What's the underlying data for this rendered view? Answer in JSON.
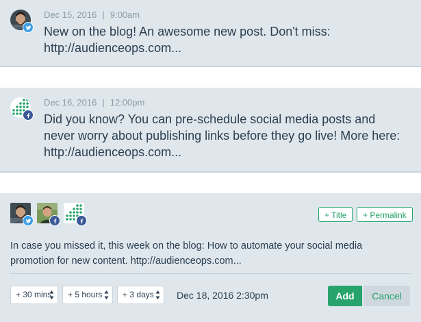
{
  "posts": [
    {
      "network": "twitter",
      "date": "Dec 15, 2016",
      "separator": "|",
      "time": "9:00am",
      "text": "New on the blog! An awesome new post. Don't miss: http://audienceops.com..."
    },
    {
      "network": "facebook",
      "date": "Dec 16, 2016",
      "separator": "|",
      "time": "12:00pm",
      "text": "Did you know? You can pre-schedule social media posts and never worry about publishing links before they go live! More here: http://audienceops.com..."
    }
  ],
  "composer": {
    "accounts": [
      {
        "avatar": "man-with-beard",
        "network": "twitter"
      },
      {
        "avatar": "man-outdoors",
        "network": "facebook"
      },
      {
        "avatar": "green-dots-logo",
        "network": "facebook"
      }
    ],
    "title_button": "+ Title",
    "permalink_button": "+ Permalink",
    "text": "In case you missed it, this week on the blog: How to automate your social media promotion for new content.  http://audienceops.com...",
    "offsets": [
      "+ 30 mins",
      "+ 5 hours",
      "+ 3 days"
    ],
    "scheduled_date": "Dec 18, 2016 2:30pm",
    "add_label": "Add",
    "cancel_label": "Cancel"
  },
  "colors": {
    "card_bg": "#dfe7ec",
    "accent_green": "#27a46b",
    "twitter_blue": "#3d9ee6",
    "facebook_blue": "#3b5998",
    "meta_gray": "#8a9aa5",
    "text_dark": "#2c3e50"
  }
}
